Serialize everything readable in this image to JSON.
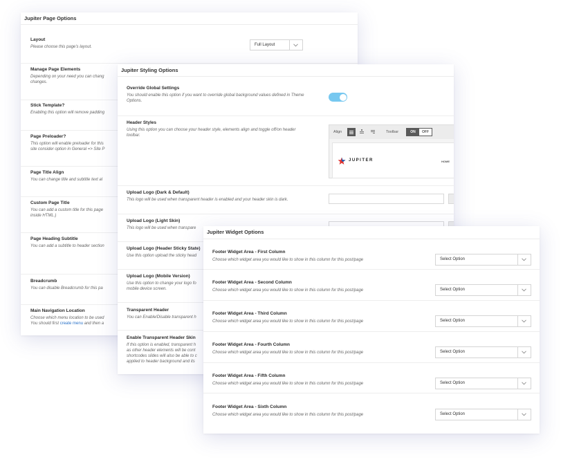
{
  "page_options": {
    "title": "Jupiter Page Options",
    "layout": {
      "label": "Layout",
      "desc": "Please choose this page's layout.",
      "value": "Full Layout"
    },
    "manage_elements": {
      "label": "Manage Page Elements",
      "desc1": "Depending on your need you can chang",
      "desc2": "changes."
    },
    "stick_template": {
      "label": "Stick Template?",
      "desc": "Enabling this option will remove padding"
    },
    "preloader": {
      "label": "Page Preloader?",
      "desc1": "This option will enable preloader for this",
      "desc2": "site consider option in General => Site P"
    },
    "title_align": {
      "label": "Page Title Align",
      "desc": "You can change title and subtitle text al"
    },
    "custom_title": {
      "label": "Custom Page Title",
      "desc1": "You can add a custom title for this page",
      "desc2": "inside HTML.)"
    },
    "heading_subtitle": {
      "label": "Page Heading Subtitle",
      "desc": "You can add a subtitle to header section"
    },
    "breadcrumb": {
      "label": "Breadcrumb",
      "desc": "You can disable Breadcrumb for this pa"
    },
    "main_nav": {
      "label": "Main Navigation Location",
      "desc1": "Choose which menu location to be used",
      "desc2_pre": "You should first ",
      "desc2_link": "create menu",
      "desc2_post": " and then a"
    }
  },
  "styling_options": {
    "title": "Jupiter Styling Options",
    "override": {
      "label": "Override Global Settings",
      "desc1": "You should enable this option if you want to override global background values defined in Theme",
      "desc2": "Options.",
      "enabled": true
    },
    "header_styles": {
      "label": "Header Styles",
      "desc1": "Using this option you can choose your header style, elements align and toggle off/on header",
      "desc2": "toolbar.",
      "align_label": "Align",
      "toolbar_label": "Toolbar",
      "on_label": "ON",
      "off_label": "OFF",
      "logo_text": "JUPITER",
      "nav_text": "HOME"
    },
    "logo_dark": {
      "label": "Upload Logo (Dark & Default)",
      "desc": "This logo will be used when transparent header is enabled and your header skin is dark."
    },
    "logo_light": {
      "label": "Upload Logo (Light Skin)",
      "desc": "This logo will be used when transpare"
    },
    "logo_sticky": {
      "label": "Upload Logo (Header Sticky State)",
      "desc": "Use this option upload the sticky head"
    },
    "logo_mobile": {
      "label": "Upload Logo (Mobile Version)",
      "desc1": "Use this option to change your logo fo",
      "desc2": "mobile device screen."
    },
    "transparent_header": {
      "label": "Transparent Header",
      "desc": "You can Enable/Disable transparent h"
    },
    "transparent_skin": {
      "label": "Enable Transparent Header Skin",
      "desc1": "If this option is enabled, transparent h",
      "desc2": "as other header elements will be cont",
      "desc3": "shortcodes slides will also be able to c",
      "desc4": "applied to header background and its"
    }
  },
  "widget_options": {
    "title": "Jupiter Widget Options",
    "desc": "Choose which widget area you would like to show in this column for this post/page",
    "select_value": "Select Option",
    "columns": [
      {
        "label": "Footer Widget Area - First Column"
      },
      {
        "label": "Footer Widget Area - Second Column"
      },
      {
        "label": "Footer Widget Area - Third Column"
      },
      {
        "label": "Footer Widget Area - Fourth Column"
      },
      {
        "label": "Footer Widget Area - Fifth Column"
      },
      {
        "label": "Footer Widget Area - Sixth Column"
      }
    ]
  },
  "colors": {
    "toggle_on": "#77c8f0",
    "link": "#2a72c8",
    "logo_red": "#e0332f",
    "logo_blue": "#1a5fb4"
  }
}
